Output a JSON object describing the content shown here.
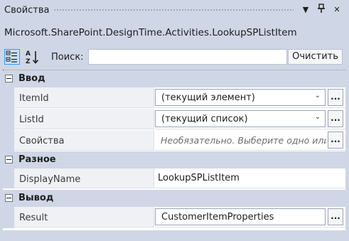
{
  "window": {
    "title": "Свойства",
    "pin_symbol": "📌",
    "close_symbol": "✕",
    "dropdown_symbol": "▼"
  },
  "object_name": "Microsoft.SharePoint.DesignTime.Activities.LookupSPListItem",
  "toolbar": {
    "search_label": "Поиск:",
    "search_value": "",
    "clear_label": "Очистить"
  },
  "categories": [
    {
      "label": "Ввод",
      "properties": [
        {
          "name": "ItemId",
          "value": "(текущий элемент)",
          "editor": "combo"
        },
        {
          "name": "ListId",
          "value": "(текущий список)",
          "editor": "combo"
        },
        {
          "name": "Свойства",
          "value": "Необязательно. Выберите одно или",
          "editor": "hint"
        }
      ]
    },
    {
      "label": "Разное",
      "properties": [
        {
          "name": "DisplayName",
          "value": "LookupSPListItem",
          "editor": "text"
        }
      ]
    },
    {
      "label": "Вывод",
      "properties": [
        {
          "name": "Result",
          "value": "CustomerItemProperties",
          "editor": "combo"
        }
      ]
    }
  ],
  "ellipsis_label": "...",
  "combo_arrow": "⌄",
  "colors": {
    "panel_bg": "#cfd6e5",
    "grid_bg": "#ffffff",
    "active_tool": "#3399ff"
  }
}
